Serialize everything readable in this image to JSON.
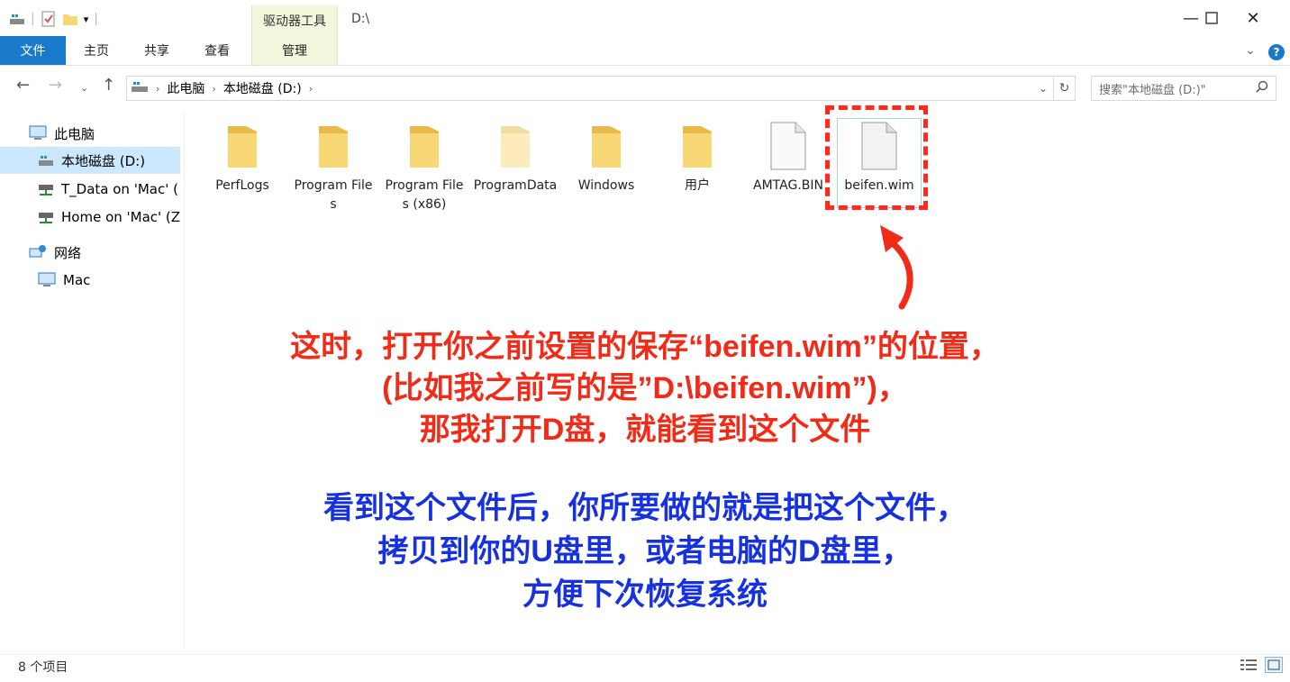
{
  "window": {
    "title": "D:\\",
    "tool_header": "驱动器工具"
  },
  "ribbon": {
    "tabs": [
      "文件",
      "主页",
      "共享",
      "查看",
      "管理"
    ]
  },
  "address": {
    "path": [
      "此电脑",
      "本地磁盘 (D:)"
    ],
    "search_placeholder": "搜索\"本地磁盘 (D:)\""
  },
  "nav": {
    "items": [
      {
        "label": "此电脑",
        "icon": "computer-icon"
      },
      {
        "label": "本地磁盘 (D:)",
        "icon": "drive-icon",
        "selected": true
      },
      {
        "label": "T_Data on 'Mac' (",
        "icon": "network-drive-icon"
      },
      {
        "label": "Home on 'Mac' (Z",
        "icon": "network-drive-icon"
      },
      {
        "label": "网络",
        "icon": "network-icon"
      },
      {
        "label": "Mac",
        "icon": "computer-icon"
      }
    ]
  },
  "files": [
    {
      "name": "PerfLogs",
      "type": "folder"
    },
    {
      "name": "Program Files",
      "type": "folder"
    },
    {
      "name": "Program Files (x86)",
      "type": "folder"
    },
    {
      "name": "ProgramData",
      "type": "folder-hidden"
    },
    {
      "name": "Windows",
      "type": "folder"
    },
    {
      "name": "用户",
      "type": "folder"
    },
    {
      "name": "AMTAG.BIN",
      "type": "file"
    },
    {
      "name": "beifen.wim",
      "type": "file",
      "selected": true
    }
  ],
  "annotation": {
    "red_lines": [
      "这时，打开你之前设置的保存“beifen.wim”的位置，",
      "(比如我之前写的是”D:\\beifen.wim”)，",
      "那我打开D盘，就能看到这个文件"
    ],
    "blue_lines": [
      "看到这个文件后，你所要做的就是把这个文件，",
      "拷贝到你的U盘里，或者电脑的D盘里，",
      "方便下次恢复系统"
    ]
  },
  "status": {
    "item_count": "8 个项目"
  },
  "colors": {
    "accent": "#1979ca",
    "annotation_red": "#f22b18",
    "annotation_blue": "#1632e0",
    "folder": "#f8d775"
  }
}
